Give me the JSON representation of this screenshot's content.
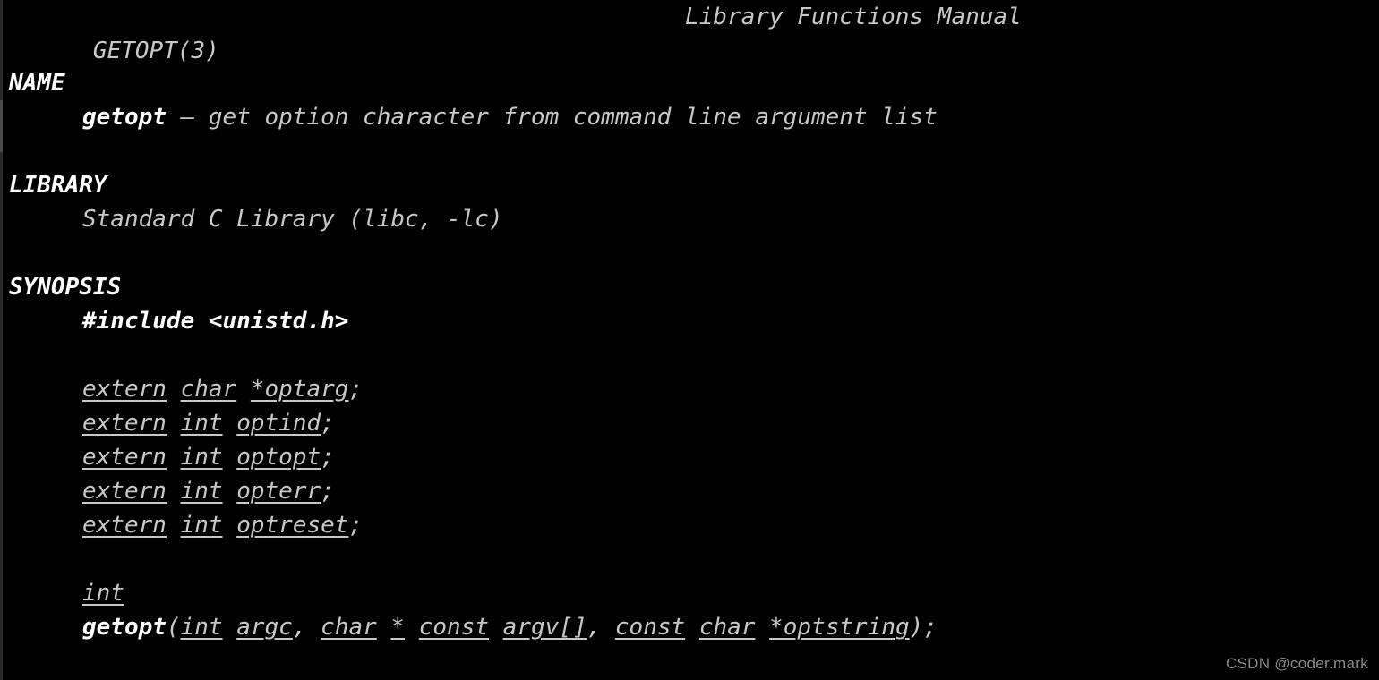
{
  "window": {
    "background_color": "#000000",
    "text_color": "#c8c8c8",
    "bold_color": "#ffffff"
  },
  "header": {
    "left": "GETOPT(3)",
    "center": "Library Functions Manual"
  },
  "sections": [
    {
      "title": "NAME",
      "lines": [
        {
          "spans": [
            {
              "text": "getopt",
              "style": "bold"
            },
            {
              "text": " ",
              "style": "plain"
            },
            {
              "text": "– get option character from command line argument list",
              "style": "plain"
            }
          ]
        }
      ]
    },
    {
      "title": "LIBRARY",
      "lines": [
        {
          "spans": [
            {
              "text": "Standard C Library (libc, -lc)",
              "style": "plain"
            }
          ]
        }
      ]
    },
    {
      "title": "SYNOPSIS",
      "lines": [
        {
          "spans": [
            {
              "text": "#include <unistd.h>",
              "style": "bold"
            }
          ]
        },
        {
          "spans": []
        },
        {
          "spans": [
            {
              "text": "extern",
              "style": "under"
            },
            {
              "text": " ",
              "style": "plain"
            },
            {
              "text": "char",
              "style": "under"
            },
            {
              "text": " ",
              "style": "plain"
            },
            {
              "text": "*optarg",
              "style": "under"
            },
            {
              "text": ";",
              "style": "plain"
            }
          ]
        },
        {
          "spans": [
            {
              "text": "extern",
              "style": "under"
            },
            {
              "text": " ",
              "style": "plain"
            },
            {
              "text": "int",
              "style": "under"
            },
            {
              "text": " ",
              "style": "plain"
            },
            {
              "text": "optind",
              "style": "under"
            },
            {
              "text": ";",
              "style": "plain"
            }
          ]
        },
        {
          "spans": [
            {
              "text": "extern",
              "style": "under"
            },
            {
              "text": " ",
              "style": "plain"
            },
            {
              "text": "int",
              "style": "under"
            },
            {
              "text": " ",
              "style": "plain"
            },
            {
              "text": "optopt",
              "style": "under"
            },
            {
              "text": ";",
              "style": "plain"
            }
          ]
        },
        {
          "spans": [
            {
              "text": "extern",
              "style": "under"
            },
            {
              "text": " ",
              "style": "plain"
            },
            {
              "text": "int",
              "style": "under"
            },
            {
              "text": " ",
              "style": "plain"
            },
            {
              "text": "opterr",
              "style": "under"
            },
            {
              "text": ";",
              "style": "plain"
            }
          ]
        },
        {
          "spans": [
            {
              "text": "extern",
              "style": "under"
            },
            {
              "text": " ",
              "style": "plain"
            },
            {
              "text": "int",
              "style": "under"
            },
            {
              "text": " ",
              "style": "plain"
            },
            {
              "text": "optreset",
              "style": "under"
            },
            {
              "text": ";",
              "style": "plain"
            }
          ]
        },
        {
          "spans": []
        },
        {
          "spans": [
            {
              "text": "int",
              "style": "under"
            }
          ]
        },
        {
          "spans": [
            {
              "text": "getopt",
              "style": "bold"
            },
            {
              "text": "(",
              "style": "plain"
            },
            {
              "text": "int",
              "style": "under"
            },
            {
              "text": " ",
              "style": "plain"
            },
            {
              "text": "argc",
              "style": "under"
            },
            {
              "text": ", ",
              "style": "plain"
            },
            {
              "text": "char",
              "style": "under"
            },
            {
              "text": " ",
              "style": "plain"
            },
            {
              "text": "*",
              "style": "under"
            },
            {
              "text": " ",
              "style": "plain"
            },
            {
              "text": "const",
              "style": "under"
            },
            {
              "text": " ",
              "style": "plain"
            },
            {
              "text": "argv[]",
              "style": "under"
            },
            {
              "text": ", ",
              "style": "plain"
            },
            {
              "text": "const",
              "style": "under"
            },
            {
              "text": " ",
              "style": "plain"
            },
            {
              "text": "char",
              "style": "under"
            },
            {
              "text": " ",
              "style": "plain"
            },
            {
              "text": "*optstring",
              "style": "under"
            },
            {
              "text": ");",
              "style": "plain"
            }
          ]
        }
      ]
    }
  ],
  "watermark": {
    "text": "CSDN @coder.mark"
  }
}
